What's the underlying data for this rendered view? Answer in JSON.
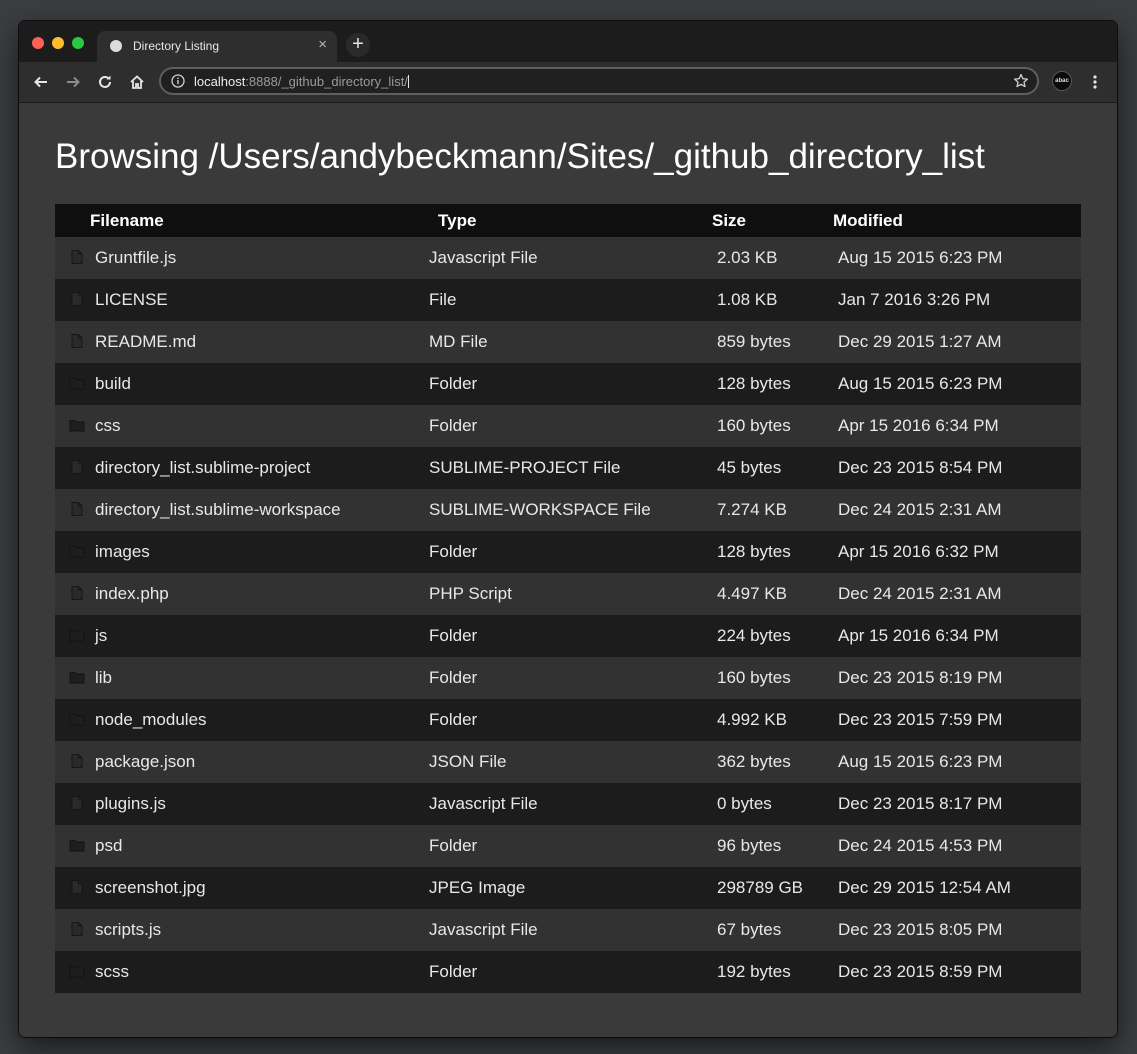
{
  "browser": {
    "tab_title": "Directory Listing",
    "url_host": "localhost",
    "url_rest": ":8888/_github_directory_list/",
    "extension_label": "abac"
  },
  "page": {
    "heading": "Browsing /Users/andybeckmann/Sites/_github_directory_list"
  },
  "table": {
    "headers": [
      "Filename",
      "Type",
      "Size",
      "Modified"
    ],
    "rows": [
      {
        "icon": "file-icon",
        "name": "Gruntfile.js",
        "type": "Javascript File",
        "size": "2.03 KB",
        "modified": "Aug 15 2015 6:23 PM"
      },
      {
        "icon": "file-icon",
        "name": "LICENSE",
        "type": "File",
        "size": "1.08 KB",
        "modified": "Jan 7 2016 3:26 PM"
      },
      {
        "icon": "file-icon",
        "name": "README.md",
        "type": "MD File",
        "size": "859 bytes",
        "modified": "Dec 29 2015 1:27 AM"
      },
      {
        "icon": "folder-icon",
        "name": "build",
        "type": "Folder",
        "size": "128 bytes",
        "modified": "Aug 15 2015 6:23 PM"
      },
      {
        "icon": "folder-icon",
        "name": "css",
        "type": "Folder",
        "size": "160 bytes",
        "modified": "Apr 15 2016 6:34 PM"
      },
      {
        "icon": "file-icon",
        "name": "directory_list.sublime-project",
        "type": "SUBLIME-PROJECT File",
        "size": "45 bytes",
        "modified": "Dec 23 2015 8:54 PM"
      },
      {
        "icon": "file-icon",
        "name": "directory_list.sublime-workspace",
        "type": "SUBLIME-WORKSPACE File",
        "size": "7.274 KB",
        "modified": "Dec 24 2015 2:31 AM"
      },
      {
        "icon": "folder-icon",
        "name": "images",
        "type": "Folder",
        "size": "128 bytes",
        "modified": "Apr 15 2016 6:32 PM"
      },
      {
        "icon": "file-icon",
        "name": "index.php",
        "type": "PHP Script",
        "size": "4.497 KB",
        "modified": "Dec 24 2015 2:31 AM"
      },
      {
        "icon": "folder-icon",
        "name": "js",
        "type": "Folder",
        "size": "224 bytes",
        "modified": "Apr 15 2016 6:34 PM"
      },
      {
        "icon": "folder-icon",
        "name": "lib",
        "type": "Folder",
        "size": "160 bytes",
        "modified": "Dec 23 2015 8:19 PM"
      },
      {
        "icon": "folder-icon",
        "name": "node_modules",
        "type": "Folder",
        "size": "4.992 KB",
        "modified": "Dec 23 2015 7:59 PM"
      },
      {
        "icon": "file-icon",
        "name": "package.json",
        "type": "JSON File",
        "size": "362 bytes",
        "modified": "Aug 15 2015 6:23 PM"
      },
      {
        "icon": "file-icon",
        "name": "plugins.js",
        "type": "Javascript File",
        "size": "0 bytes",
        "modified": "Dec 23 2015 8:17 PM"
      },
      {
        "icon": "folder-icon",
        "name": "psd",
        "type": "Folder",
        "size": "96 bytes",
        "modified": "Dec 24 2015 4:53 PM"
      },
      {
        "icon": "file-icon",
        "name": "screenshot.jpg",
        "type": "JPEG Image",
        "size": "298789 GB",
        "modified": "Dec 29 2015 12:54 AM"
      },
      {
        "icon": "file-icon",
        "name": "scripts.js",
        "type": "Javascript File",
        "size": "67 bytes",
        "modified": "Dec 23 2015 8:05 PM"
      },
      {
        "icon": "folder-icon",
        "name": "scss",
        "type": "Folder",
        "size": "192 bytes",
        "modified": "Dec 23 2015 8:59 PM"
      }
    ]
  }
}
